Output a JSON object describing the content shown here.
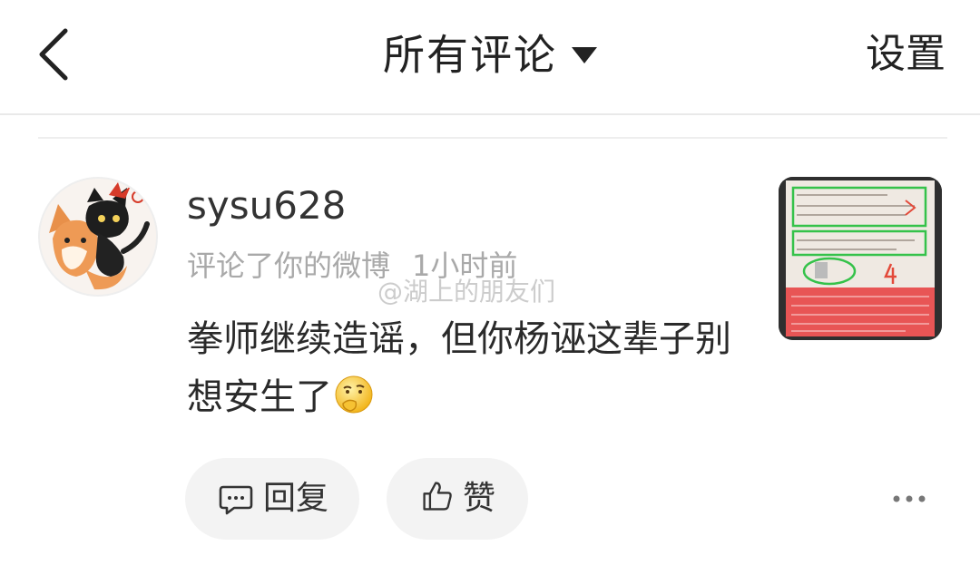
{
  "header": {
    "title": "所有评论",
    "settings_label": "设置"
  },
  "comment": {
    "username": "sysu628",
    "action": "评论了你的微博",
    "time": "1小时前",
    "text": "拳师继续造谣，但你杨诬这辈子别想安生了",
    "watermark": "@湖上的朋友们"
  },
  "actions": {
    "reply_label": "回复",
    "like_label": "赞"
  },
  "icons": [
    "back-icon",
    "caret-down-icon",
    "avatar",
    "thinking-emoji-icon",
    "reply-icon",
    "like-icon",
    "more-icon"
  ],
  "colors": {
    "text_primary": "#222222",
    "text_secondary": "#a9a9a9",
    "pill_bg": "#f3f3f3",
    "divider": "#e9e9e9"
  }
}
